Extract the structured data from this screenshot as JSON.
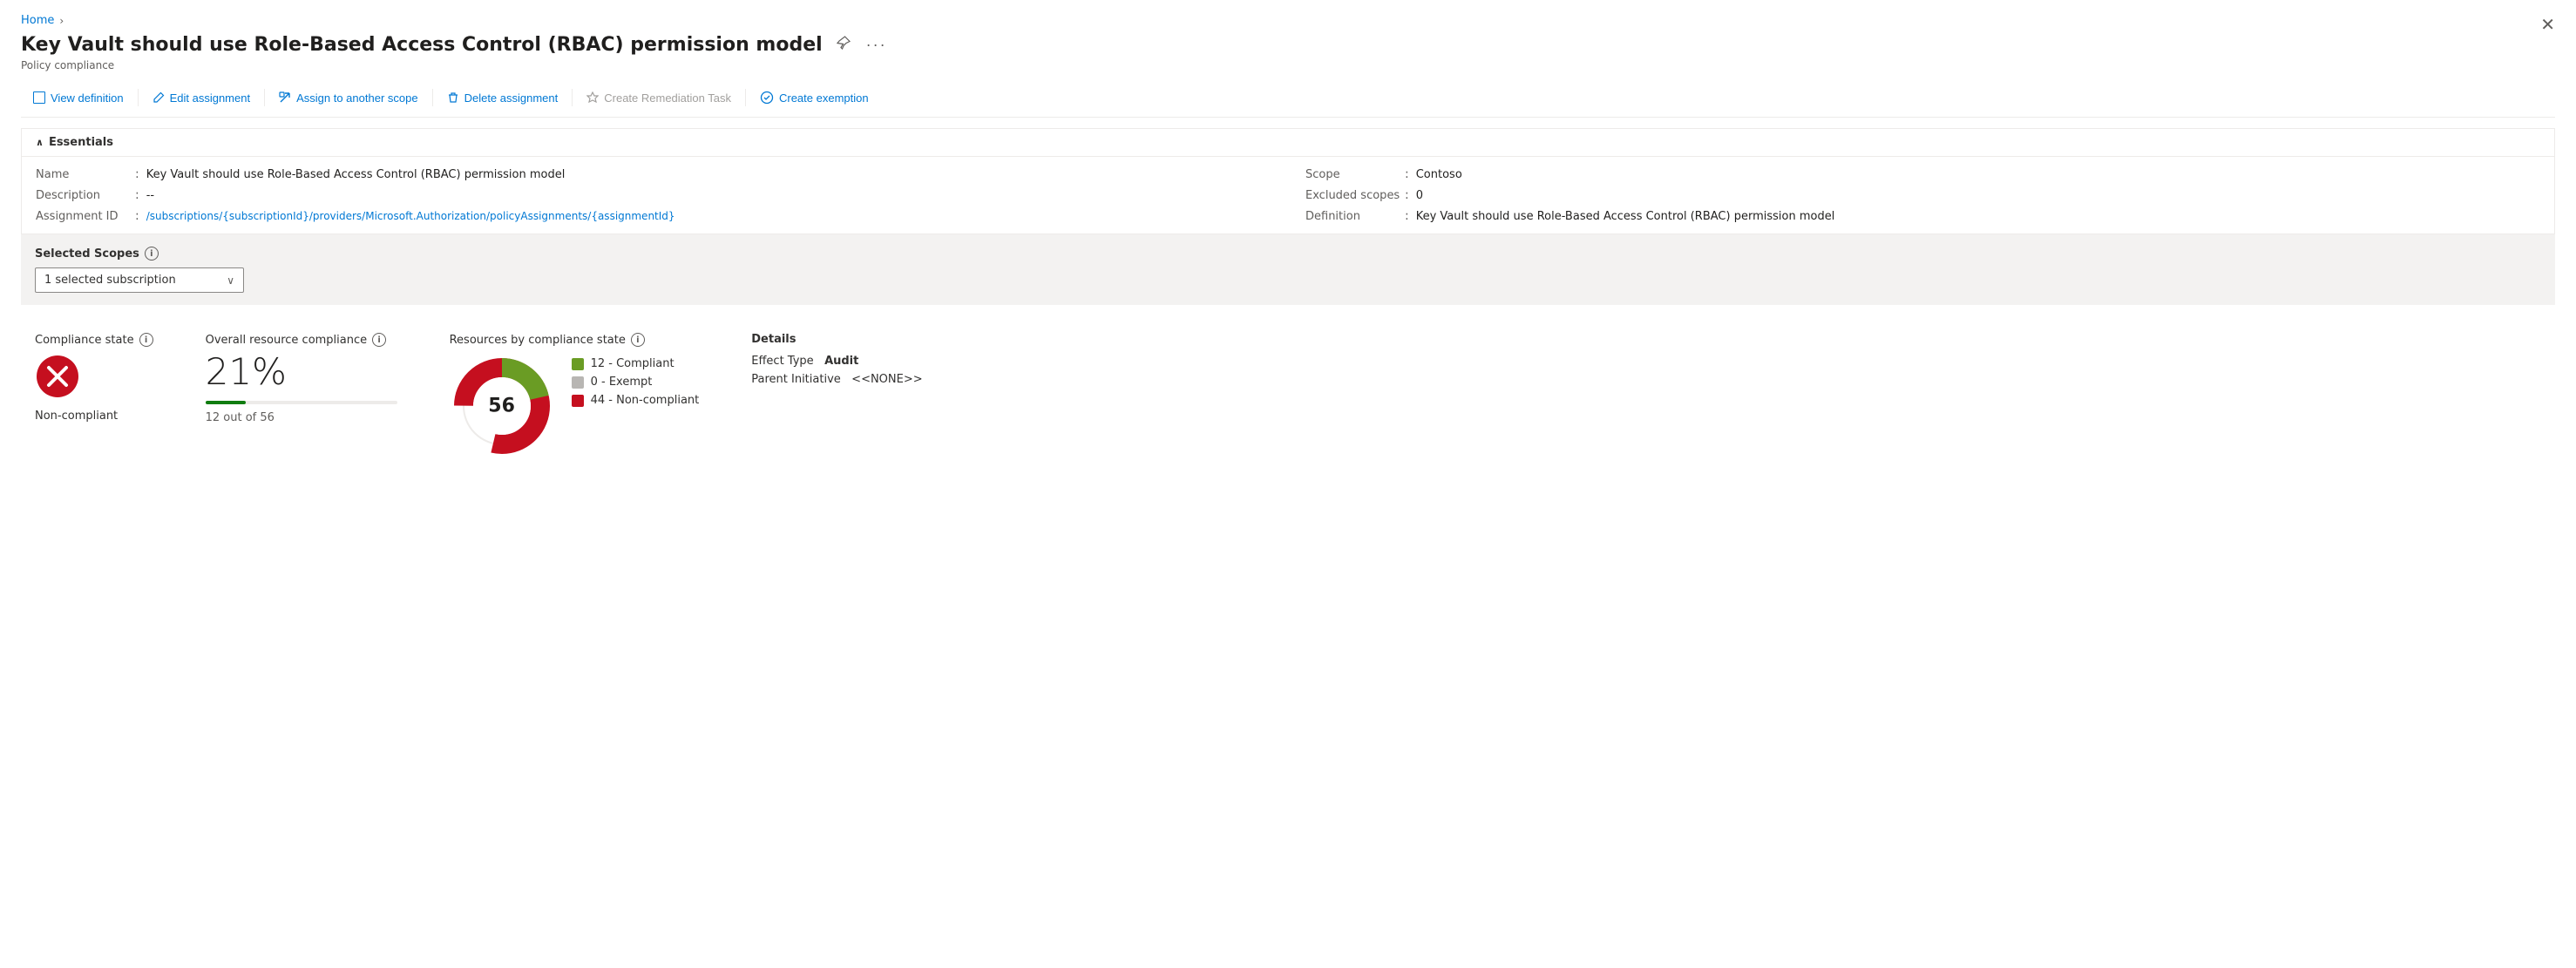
{
  "breadcrumb": {
    "home": "Home",
    "separator": "›"
  },
  "page": {
    "title": "Key Vault should use Role-Based Access Control (RBAC) permission model",
    "subtitle": "Policy compliance"
  },
  "toolbar": {
    "view_definition": "View definition",
    "edit_assignment": "Edit assignment",
    "assign_to_another_scope": "Assign to another scope",
    "delete_assignment": "Delete assignment",
    "create_remediation_task": "Create Remediation Task",
    "create_exemption": "Create exemption"
  },
  "essentials": {
    "header": "Essentials",
    "fields": {
      "name_label": "Name",
      "name_value": "Key Vault should use Role-Based Access Control (RBAC) permission model",
      "description_label": "Description",
      "description_value": "--",
      "assignment_id_label": "Assignment ID",
      "assignment_id_value": "/subscriptions/{subscriptionId}/providers/Microsoft.Authorization/policyAssignments/{assignmentId}",
      "scope_label": "Scope",
      "scope_value": "Contoso",
      "excluded_scopes_label": "Excluded scopes",
      "excluded_scopes_value": "0",
      "definition_label": "Definition",
      "definition_value": "Key Vault should use Role-Based Access Control (RBAC) permission model"
    }
  },
  "scope_section": {
    "label": "Selected Scopes",
    "dropdown_value": "1 selected subscription"
  },
  "compliance": {
    "state_title": "Compliance state",
    "state_value": "Non-compliant",
    "overall_title": "Overall resource compliance",
    "overall_percent": "21%",
    "overall_fraction": "12 out of 56",
    "bar_percent": 21,
    "resources_title": "Resources by compliance state",
    "donut_total": "56",
    "legend": [
      {
        "color": "#6a9c24",
        "label": "12 - Compliant"
      },
      {
        "color": "#b8b6b3",
        "label": "0 - Exempt"
      },
      {
        "color": "#c50f1f",
        "label": "44 - Non-compliant"
      }
    ],
    "donut_segments": {
      "compliant_pct": 21.4,
      "exempt_pct": 0,
      "noncompliant_pct": 78.6
    }
  },
  "details": {
    "title": "Details",
    "effect_type_label": "Effect Type",
    "effect_type_value": "Audit",
    "parent_initiative_label": "Parent Initiative",
    "parent_initiative_value": "<<NONE>>"
  },
  "icons": {
    "pin": "📌",
    "more": "···",
    "close": "✕",
    "chevron_down": "∨",
    "info": "i",
    "view_def": "□",
    "edit": "✎",
    "assign": "↗",
    "delete": "🗑",
    "remediation": "⚡",
    "exemption": "⊘"
  }
}
